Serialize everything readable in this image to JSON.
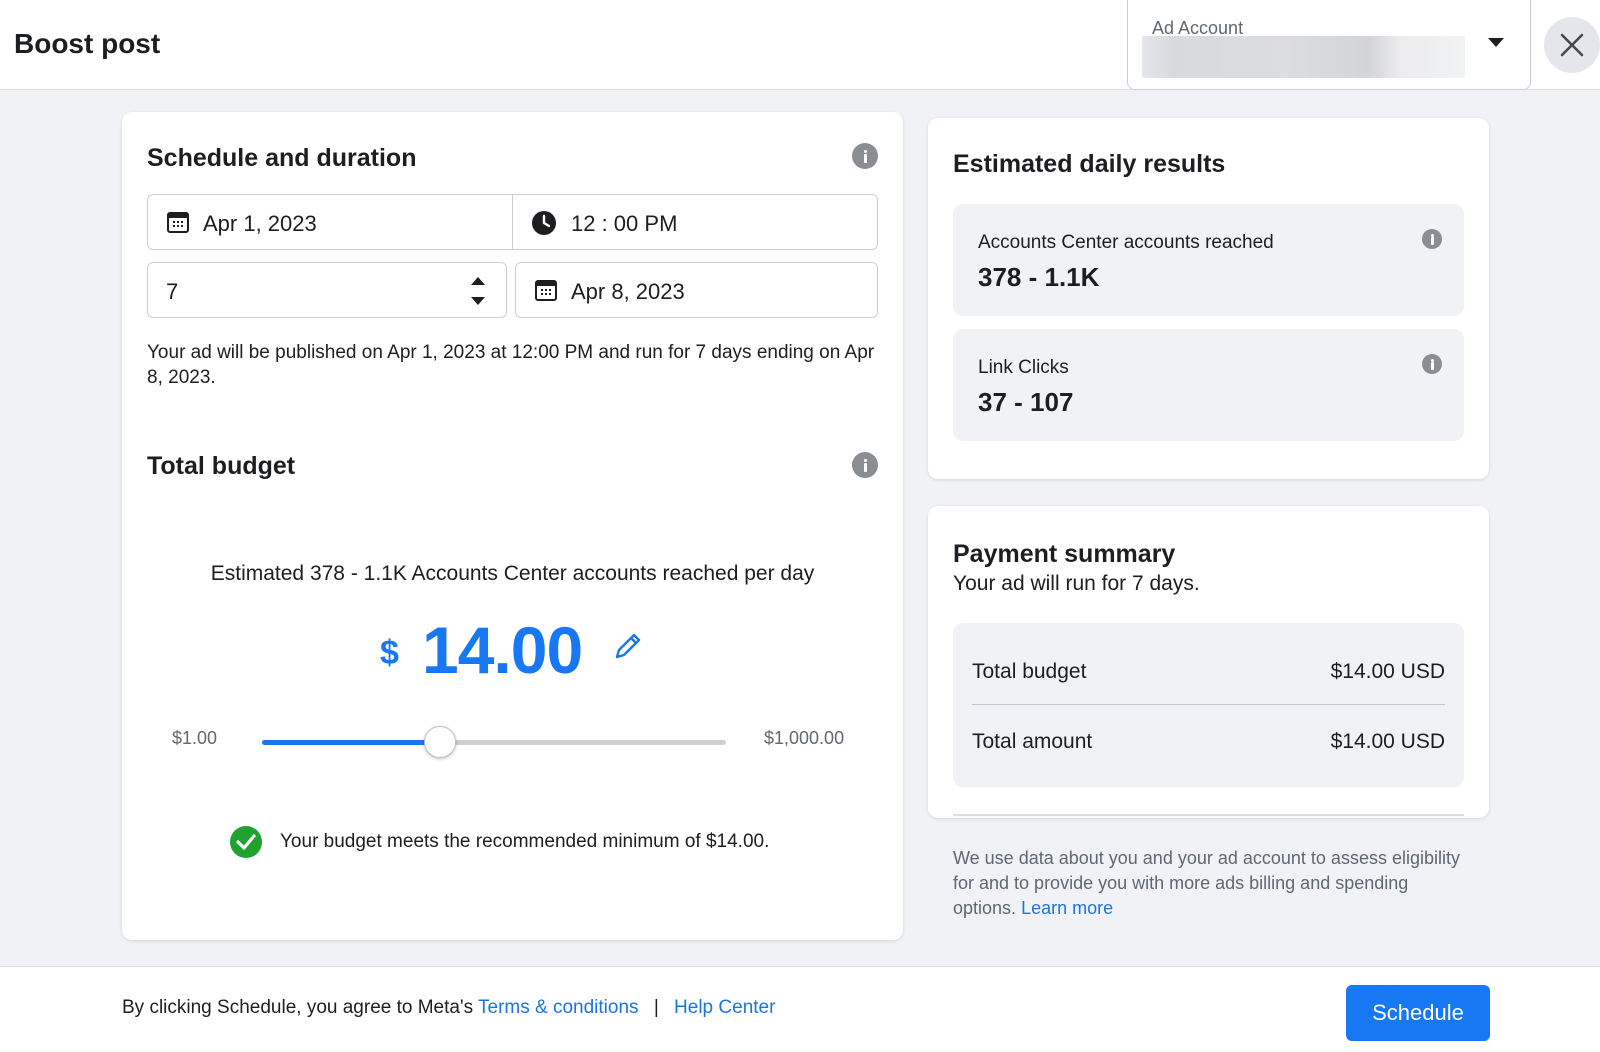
{
  "header": {
    "title": "Boost post",
    "ad_account_label": "Ad Account"
  },
  "schedule": {
    "title": "Schedule and duration",
    "start_date": "Apr 1, 2023",
    "start_time": "12 : 00 PM",
    "duration_days": "7",
    "end_date": "Apr 8, 2023",
    "summary": "Your ad will be published on Apr 1, 2023 at 12:00 PM and run for 7 days ending on Apr 8, 2023."
  },
  "budget": {
    "title": "Total budget",
    "estimate_text": "Estimated 378 - 1.1K Accounts Center accounts reached per day",
    "currency_symbol": "$",
    "amount": "14.00",
    "slider_min_label": "$1.00",
    "slider_max_label": "$1,000.00",
    "slider_value_fraction": 0.383,
    "recommendation_text": "Your budget meets the recommended minimum of $14.00."
  },
  "estimated_results": {
    "title": "Estimated daily results",
    "metrics": [
      {
        "label": "Accounts Center accounts reached",
        "value": "378 - 1.1K"
      },
      {
        "label": "Link Clicks",
        "value": "37 - 107"
      }
    ]
  },
  "payment": {
    "title": "Payment summary",
    "subtitle": "Your ad will run for 7 days.",
    "rows": [
      {
        "label": "Total budget",
        "value": "$14.00 USD"
      },
      {
        "label": "Total amount",
        "value": "$14.00 USD"
      }
    ]
  },
  "disclaimer": {
    "text": "We use data about you and your ad account to assess eligibility for and to provide you with more ads billing and spending options.",
    "link": "Learn more"
  },
  "footer": {
    "text": "By clicking Schedule, you agree to Meta's",
    "terms_link": "Terms & conditions",
    "separator": "|",
    "help_link": "Help Center",
    "schedule_button": "Schedule"
  },
  "colors": {
    "accent": "#1877f2",
    "success": "#1fa22e",
    "background": "#f0f2f5"
  },
  "icons": [
    "close-icon",
    "calendar-icon",
    "clock-icon",
    "info-icon",
    "pencil-icon",
    "check-circle-icon",
    "chevron-down-icon",
    "stepper-icon"
  ]
}
